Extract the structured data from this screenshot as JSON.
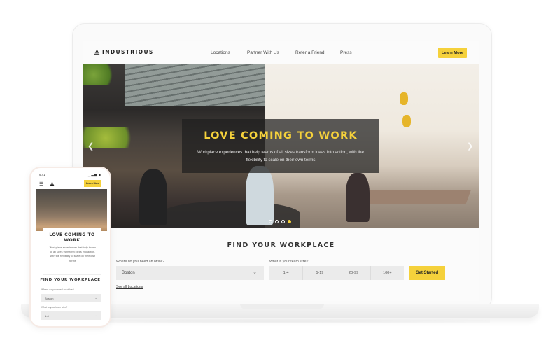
{
  "header": {
    "brand": "INDUSTRIOUS",
    "nav": [
      "Locations",
      "Partner With Us",
      "Refer a Friend",
      "Press"
    ],
    "cta_label": "Learn More"
  },
  "hero": {
    "title": "LOVE COMING TO WORK",
    "subtitle": "Workplace experiences that help teams of all sizes transform ideas into action, with the flexibility to scale on their own terms",
    "slides_total": 4,
    "active_slide": 4,
    "prev_icon": "chevron-left-icon",
    "next_icon": "chevron-right-icon"
  },
  "finder": {
    "title": "FIND YOUR WORKPLACE",
    "office_label": "Where do you need an office?",
    "office_value": "Boston",
    "team_label": "What is your team size?",
    "team_options": [
      "1-4",
      "5-19",
      "20-99",
      "100+"
    ],
    "submit_label": "Get Started",
    "see_all_label": "See all Locations"
  },
  "phone": {
    "time": "9:41",
    "signal": "▁▃▅ ▮",
    "cta_label": "Learn More",
    "card_title": "LOVE COMING TO WORK",
    "card_subtitle": "Workplace experiences that help teams of all sizes transform ideas into action, with the flexibility to scale on their own terms",
    "finder_title": "FIND YOUR WORKPLACE",
    "office_label": "Where do you need an office?",
    "office_value": "Boston",
    "team_label": "What is your team size?",
    "team_value": "1-4"
  },
  "colors": {
    "accent": "#f5d13b",
    "text_dark": "#333333",
    "field_bg": "#ebebeb"
  }
}
